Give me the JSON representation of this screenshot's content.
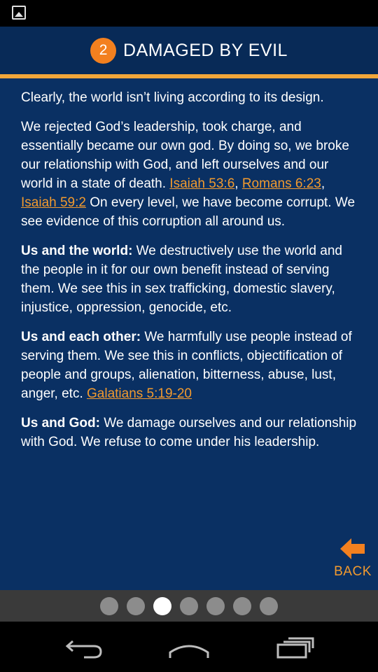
{
  "status_bar": {
    "notification_icon": "image-icon"
  },
  "header": {
    "step_number": "2",
    "title": "DAMAGED BY EVIL"
  },
  "content": {
    "p1": "Clearly, the world isn’t living according to its design.",
    "p2_text": "We rejected God’s leadership, took charge, and essentially became our own god. By doing so, we broke our relationship with God, and left ourselves and our world in a state of death. ",
    "p2_link1": "Isaiah 53:6",
    "p2_sep1": ", ",
    "p2_link2": "Romans 6:23",
    "p2_sep2": ", ",
    "p2_link3": "Isaiah 59:2",
    "p2_tail": "  On every level, we have become corrupt. We see evidence of this corruption all around us.",
    "p3_bold": "Us and the world:",
    "p3_text": " We destructively use the world and the people in it for our own benefit instead of serving them. We see this in sex trafficking, domestic slavery, injustice, oppression, genocide, etc.",
    "p4_bold": "Us and each other:",
    "p4_text": " We harmfully use people instead of serving them. We see this in conflicts, objectification of people and groups, alienation, bitterness, abuse, lust, anger, etc. ",
    "p4_link": "Galatians 5:19-20",
    "p5_bold": "Us and God:",
    "p5_text": " We damage ourselves and our relationship with God. We refuse to come under his leadership."
  },
  "back": {
    "label": "BACK",
    "icon": "arrow-left-icon"
  },
  "pager": {
    "count": 7,
    "active_index": 2
  },
  "nav": {
    "back_icon": "nav-back-icon",
    "home_icon": "nav-home-icon",
    "recents_icon": "nav-recents-icon"
  },
  "colors": {
    "background": "#0a3063",
    "header": "#082a57",
    "accent_orange": "#f3801f",
    "link": "#f29a2e",
    "rule": "#f2a73a"
  }
}
